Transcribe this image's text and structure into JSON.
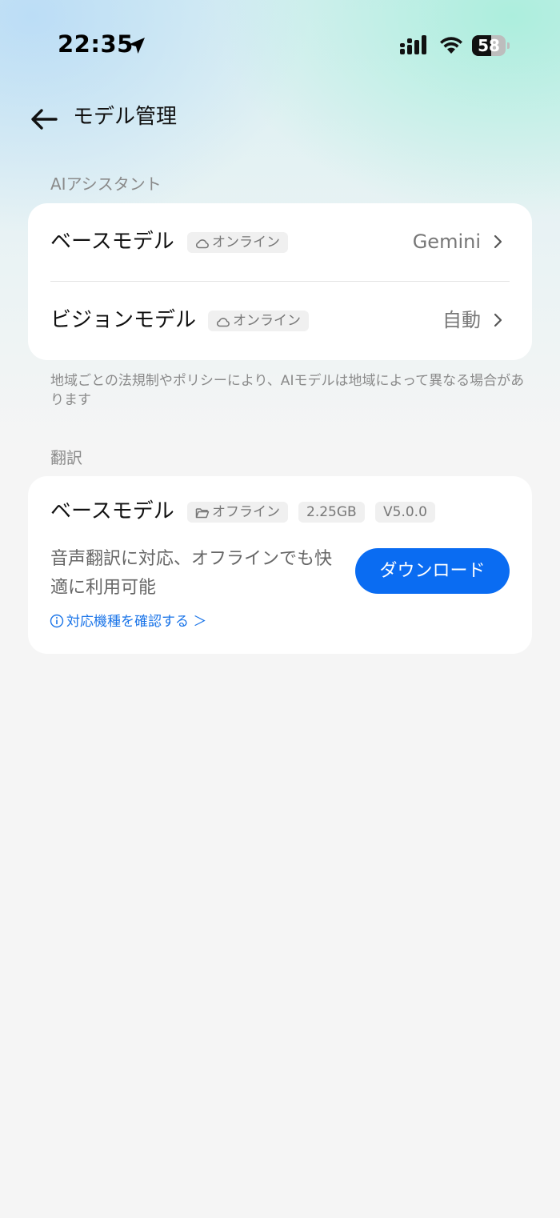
{
  "status_bar": {
    "time": "22:35",
    "battery": "58",
    "battery_level": 0.58
  },
  "header": {
    "title": "モデル管理"
  },
  "ai_assistant": {
    "section_label": "AIアシスタント",
    "rows": [
      {
        "title": "ベースモデル",
        "tag": "オンライン",
        "value": "Gemini"
      },
      {
        "title": "ビジョンモデル",
        "tag": "オンライン",
        "value": "自動"
      }
    ],
    "note": "地域ごとの法規制やポリシーにより、AIモデルは地域によって異なる場合があります"
  },
  "translation": {
    "section_label": "翻訳",
    "title": "ベースモデル",
    "tags": [
      "オフライン",
      "2.25GB",
      "V5.0.0"
    ],
    "description": "音声翻訳に対応、オフラインでも快適に利用可能",
    "download_label": "ダウンロード",
    "device_link": "対応機種を確認する ＞"
  },
  "colors": {
    "accent": "#0a6cf2",
    "link": "#1a74e8"
  }
}
